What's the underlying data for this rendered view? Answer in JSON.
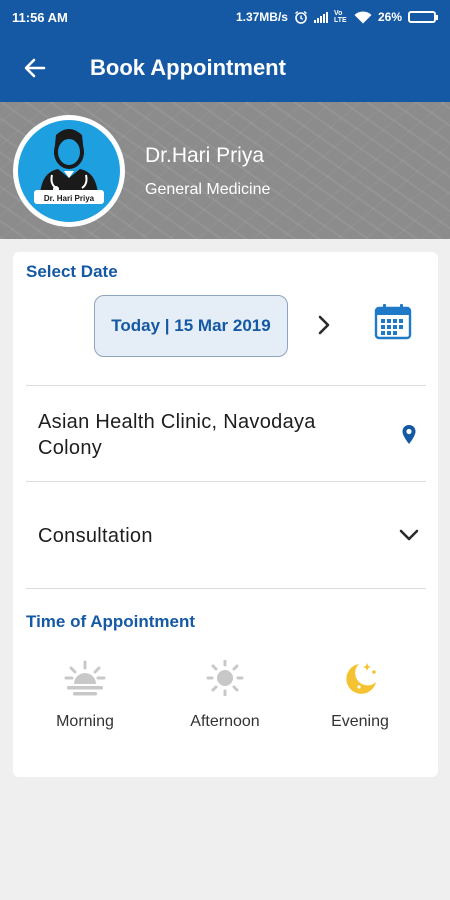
{
  "status_bar": {
    "time": "11:56 AM",
    "net_speed": "1.37MB/s",
    "volte": "Vo LTE",
    "battery_percent": "26%",
    "battery_level": 0.26
  },
  "app_bar": {
    "title": "Book Appointment",
    "back_icon": "arrow-left-icon",
    "color": "#1559a4"
  },
  "doctor": {
    "name": "Dr.Hari Priya",
    "specialty": "General Medicine",
    "avatar_caption": "Dr. Hari Priya",
    "avatar_icon": "doctor-avatar-icon"
  },
  "date_section": {
    "label": "Select Date",
    "selected_date": "Today | 15 Mar 2019",
    "next_icon": "chevron-right-icon",
    "calendar_icon": "calendar-icon"
  },
  "clinic": {
    "name": "Asian Health Clinic,  Navodaya Colony",
    "icon": "location-pin-icon"
  },
  "consultation": {
    "selected": "Consultation",
    "icon": "chevron-down-icon"
  },
  "time_section": {
    "label": "Time of Appointment",
    "slots": [
      {
        "label": "Morning",
        "icon": "sunrise-icon"
      },
      {
        "label": "Afternoon",
        "icon": "sun-icon"
      },
      {
        "label": "Evening",
        "icon": "moon-stars-icon",
        "selected": true
      }
    ],
    "accent_color": "#f5c331"
  }
}
